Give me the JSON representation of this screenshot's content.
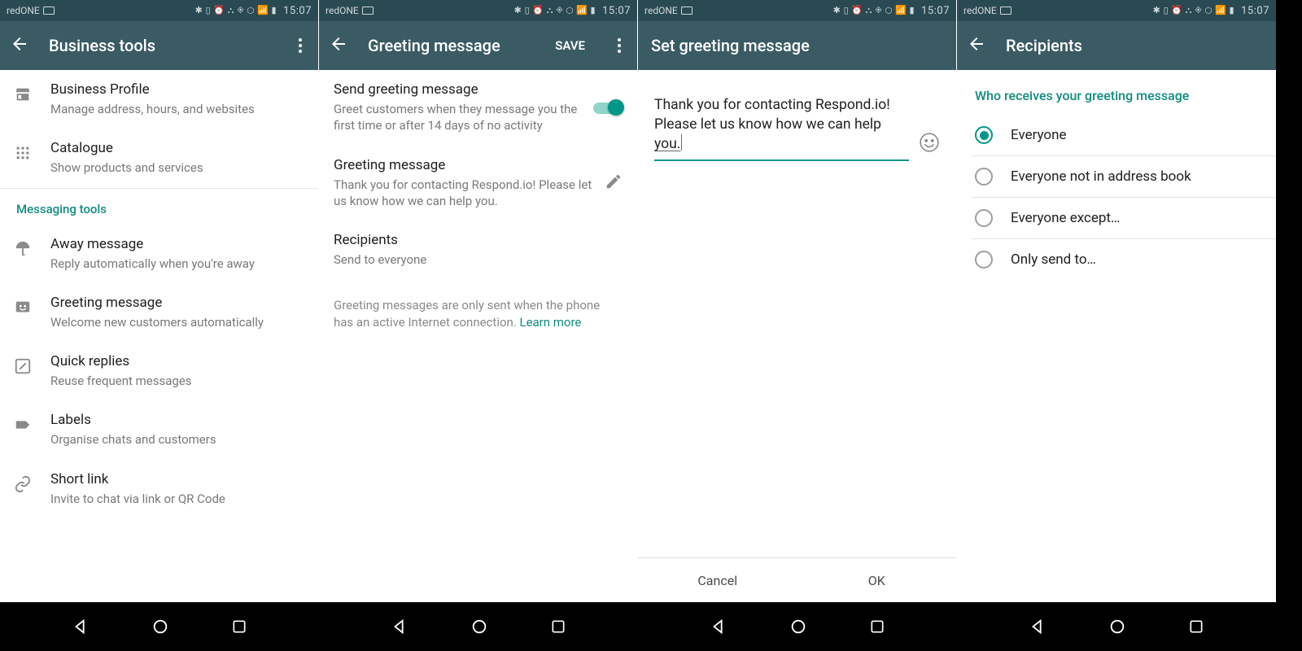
{
  "status": {
    "carrier": "redONE",
    "icons": "✱ ⏍ ⏰ ⛬ ◈ 📶 ▮▮▮",
    "time": "15:07"
  },
  "screen1": {
    "title": "Business tools",
    "items": [
      {
        "title": "Business Profile",
        "sub": "Manage address, hours, and websites"
      },
      {
        "title": "Catalogue",
        "sub": "Show products and services"
      }
    ],
    "section": "Messaging tools",
    "msgItems": [
      {
        "title": "Away message",
        "sub": "Reply automatically when you're away"
      },
      {
        "title": "Greeting message",
        "sub": "Welcome new customers automatically"
      },
      {
        "title": "Quick replies",
        "sub": "Reuse frequent messages"
      },
      {
        "title": "Labels",
        "sub": "Organise chats and customers"
      },
      {
        "title": "Short link",
        "sub": "Invite to chat via link or QR Code"
      }
    ]
  },
  "screen2": {
    "title": "Greeting message",
    "save": "SAVE",
    "toggle": {
      "title": "Send greeting message",
      "sub": "Greet customers when they message you the first time or after 14 days of no activity"
    },
    "greeting": {
      "title": "Greeting message",
      "sub": "Thank you for contacting Respond.io! Please let us know how we can help you."
    },
    "recipients": {
      "title": "Recipients",
      "sub": "Send to everyone"
    },
    "info": "Greeting messages are only sent when the phone has an active Internet connection. ",
    "learnMore": "Learn more"
  },
  "screen3": {
    "title": "Set greeting message",
    "messagePrefix": "Thank you for contacting Respond.io! Please let us know how we can help ",
    "messageUnderlined": "you.",
    "cancel": "Cancel",
    "ok": "OK"
  },
  "screen4": {
    "title": "Recipients",
    "header": "Who receives your greeting message",
    "options": [
      "Everyone",
      "Everyone not in address book",
      "Everyone except…",
      "Only send to…"
    ],
    "selected": 0
  }
}
